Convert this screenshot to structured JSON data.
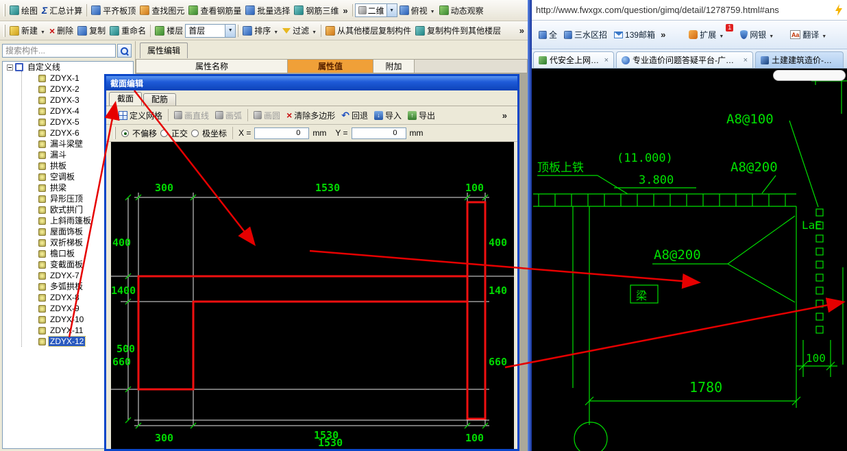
{
  "app": {
    "toolbar1": {
      "draw": "绘图",
      "sum": "汇总计算",
      "align_top": "平齐板顶",
      "find": "查找图元",
      "rebar_qty": "查看钢筋量",
      "batch_select": "批量选择",
      "rebar_3d": "钢筋三维",
      "view_mode": "二维",
      "view_angle": "俯视",
      "orbit": "动态观察"
    },
    "toolbar2": {
      "new": "新建",
      "delete": "删除",
      "copy": "复制",
      "rename": "重命名",
      "floor_label": "楼层",
      "floor_value": "首层",
      "sort": "排序",
      "filter": "过滤",
      "copy_from_floor": "从其他楼层复制构件",
      "copy_to_floor": "复制构件到其他楼层"
    },
    "search": {
      "placeholder": "搜索构件..."
    },
    "tree": {
      "root": "自定义线",
      "items": [
        "ZDYX-1",
        "ZDYX-2",
        "ZDYX-3",
        "ZDYX-4",
        "ZDYX-5",
        "ZDYX-6",
        "漏斗梁壁",
        "漏斗",
        "拱板",
        "空调板",
        "拱梁",
        "异形压顶",
        "欧式拱门",
        "上斜雨篷板",
        "屋面饰板",
        "双折梯板",
        "檐口板",
        "变截面板",
        "ZDYX-7",
        "多弧拱板",
        "ZDYX-8",
        "ZDYX-9",
        "ZDYX-10",
        "ZDYX-11",
        "ZDYX-12"
      ],
      "selected": "ZDYX-12"
    },
    "property_panel": {
      "title": "属性编辑",
      "col_name": "属性名称",
      "col_value": "属性值",
      "col_extra": "附加"
    }
  },
  "dialog": {
    "title": "截面编辑",
    "tab_section": "截面",
    "tab_rebar": "配筋",
    "toolbar": {
      "define_grid": "定义网格",
      "draw_line": "画直线",
      "draw_arc": "画弧",
      "draw_circle": "画圆",
      "clear_polygon": "清除多边形",
      "undo": "回退",
      "import": "导入",
      "export": "导出"
    },
    "modes": {
      "no_offset": "不偏移",
      "ortho": "正交",
      "polar": "极坐标"
    },
    "coord": {
      "x_label": "X =",
      "x_value": "0",
      "y_label": "Y =",
      "y_value": "0",
      "unit": "mm"
    },
    "dims": {
      "top": [
        "300",
        "1530",
        "100"
      ],
      "bottom": [
        "300",
        "1530",
        "1530",
        "100"
      ],
      "left": [
        "400",
        "1400",
        "500",
        "660"
      ],
      "right": [
        "400",
        "140",
        "660"
      ]
    }
  },
  "browser": {
    "url": "http://www.fwxgx.com/question/gimq/detail/1278759.html#ans",
    "bookmarks": {
      "b0": "全",
      "b1": "三水区招",
      "b2": "139邮箱"
    },
    "tools": {
      "extensions": "扩展",
      "badge": "1",
      "bank": "网银",
      "translate": "翻译"
    },
    "tabs": [
      "代安全上网导航",
      "专业造价问题答疑平台-广联达",
      "土建建筑造价-广..."
    ],
    "cad": {
      "top_slab": "顶板上铁",
      "elev1": "(11.000)",
      "elev2": "3.800",
      "a8_100": "A8@100",
      "a8_200_top": "A8@200",
      "lae": "LaE",
      "a8_200_mid": "A8@200",
      "beam": "梁",
      "dim_100": "100",
      "dim_1780": "1780"
    }
  }
}
